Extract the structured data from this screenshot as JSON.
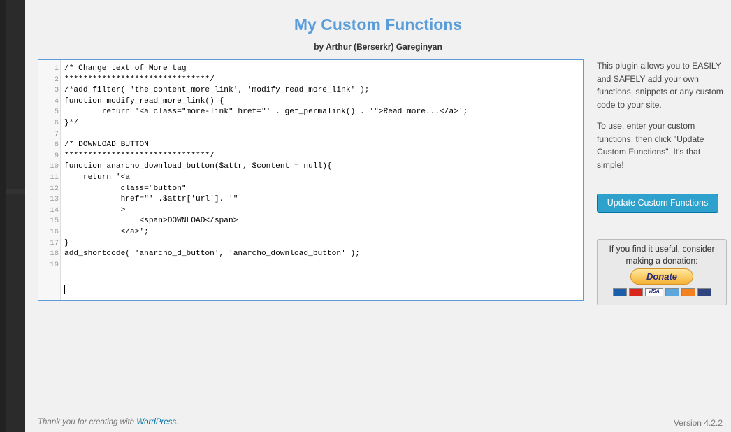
{
  "page": {
    "title": "My Custom Functions",
    "subtitle": "by Arthur (Berserkr) Gareginyan"
  },
  "editor": {
    "lines": [
      {
        "n": "1",
        "text": "/* Change text of More tag"
      },
      {
        "n": "2",
        "text": "*******************************/"
      },
      {
        "n": "3",
        "text": "/*add_filter( 'the_content_more_link', 'modify_read_more_link' );"
      },
      {
        "n": "4",
        "text": "function modify_read_more_link() {"
      },
      {
        "n": "5",
        "text": "        return '<a class=\"more-link\" href=\"' . get_permalink() . '\">Read more...</a>';"
      },
      {
        "n": "6",
        "text": "}*/"
      },
      {
        "n": "7",
        "text": ""
      },
      {
        "n": "8",
        "text": "/* DOWNLOAD BUTTON"
      },
      {
        "n": "9",
        "text": "*******************************/"
      },
      {
        "n": "10",
        "text": "function anarcho_download_button($attr, $content = null){"
      },
      {
        "n": "11",
        "text": "    return '<a"
      },
      {
        "n": "12",
        "text": "            class=\"button\""
      },
      {
        "n": "13",
        "text": "            href=\"' .$attr['url']. '\""
      },
      {
        "n": "14",
        "text": "            >"
      },
      {
        "n": "15",
        "text": "                <span>DOWNLOAD</span>"
      },
      {
        "n": "16",
        "text": "            </a>';"
      },
      {
        "n": "17",
        "text": "}"
      },
      {
        "n": "18",
        "text": "add_shortcode( 'anarcho_d_button', 'anarcho_download_button' );"
      },
      {
        "n": "19",
        "text": ""
      }
    ]
  },
  "sidebar": {
    "description": "This plugin allows you to EASILY and SAFELY add your own functions, snippets or any custom code to your site.",
    "instructions": "To use, enter your custom functions, then click \"Update Custom Functions\". It's that simple!",
    "update_button": "Update Custom Functions",
    "donation_text": "If you find it useful, consider making a donation:",
    "donate_button": "Donate",
    "card_icons": [
      "maestro-card-icon",
      "mastercard-icon",
      "visa-card-icon",
      "amex-card-icon",
      "discover-card-icon",
      "bank-icon"
    ],
    "visa_label": "VISA"
  },
  "footer": {
    "thanks_prefix": "Thank you for creating with",
    "thanks_link": "WordPress",
    "thanks_suffix": ".",
    "version": "Version 4.2.2"
  },
  "colors": {
    "accent": "#2ea2cc",
    "title": "#5b9dd9",
    "admin_menu": "#222222"
  }
}
